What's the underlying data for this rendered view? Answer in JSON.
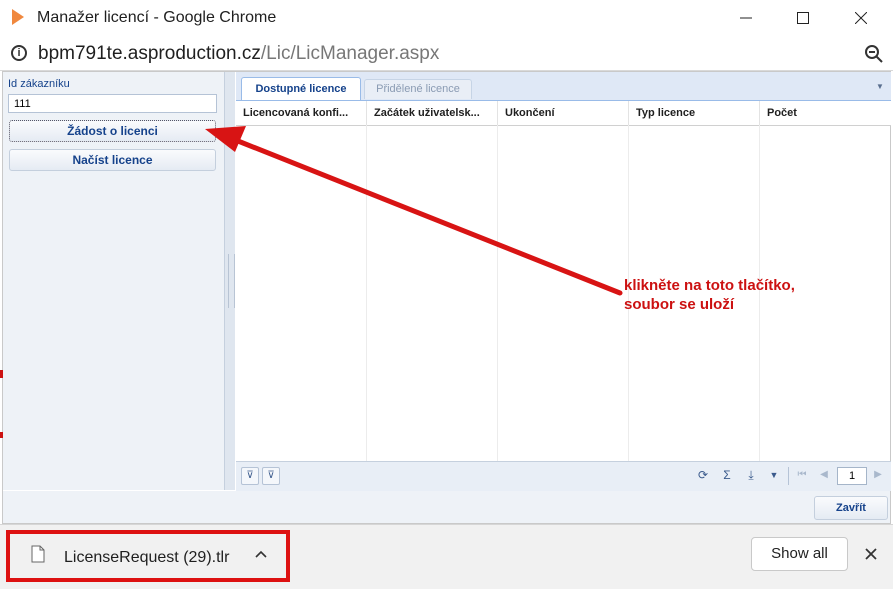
{
  "window": {
    "title": "Manažer licencí - Google Chrome"
  },
  "address": {
    "host": "bpm791te.asproduction.cz",
    "path": "/Lic/LicManager.aspx"
  },
  "left_panel": {
    "customer_label": "Id zákazníku",
    "customer_value": "111",
    "request_button": "Žádost o licenci",
    "load_button": "Načíst licence"
  },
  "tabs": [
    {
      "label": "Dostupné licence",
      "active": true
    },
    {
      "label": "Přidělené licence",
      "active": false
    }
  ],
  "grid": {
    "columns": [
      "Licencovaná konfi...",
      "Začátek uživatelsk...",
      "Ukončení",
      "Typ licence",
      "Počet"
    ],
    "rows": [],
    "page": "1"
  },
  "footer": {
    "close_button": "Zavřít"
  },
  "annotation": {
    "line1": "klikněte na toto tlačítko,",
    "line2": "soubor se uloží",
    "color": "#cc1111"
  },
  "download_bar": {
    "file_name": "LicenseRequest (29).tlr",
    "show_all": "Show all",
    "highlight_color": "#dd1111"
  }
}
